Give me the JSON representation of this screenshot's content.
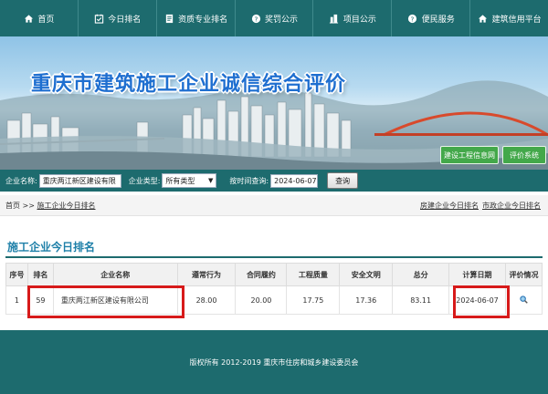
{
  "nav": [
    {
      "label": "首页",
      "icon": "home-icon"
    },
    {
      "label": "今日排名",
      "icon": "calendar-check-icon"
    },
    {
      "label": "资质专业排名",
      "icon": "document-icon"
    },
    {
      "label": "奖罚公示",
      "icon": "question-circle-icon"
    },
    {
      "label": "项目公示",
      "icon": "building-icon"
    },
    {
      "label": "便民服务",
      "icon": "help-icon"
    },
    {
      "label": "建筑信用平台",
      "icon": "home-icon"
    }
  ],
  "banner": {
    "title": "重庆市建筑施工企业诚信综合评价",
    "btn_info": "建设工程信息网",
    "btn_eval": "评价系统"
  },
  "search": {
    "company_label": "企业名称:",
    "company_value": "重庆两江新区建设有限",
    "type_label": "企业类型:",
    "type_value": "所有类型",
    "date_label": "按时间查询:",
    "date_value": "2024-06-07",
    "query_button": "查询"
  },
  "breadcrumb": {
    "home": "首页",
    "sep": ">>",
    "current": "施工企业今日排名",
    "right_1": "房建企业今日排名",
    "right_2": "市政企业今日排名"
  },
  "section": {
    "title": "施工企业今日排名"
  },
  "table": {
    "headers": [
      "序号",
      "排名",
      "企业名称",
      "遵常行为",
      "合同履约",
      "工程质量",
      "安全文明",
      "总分",
      "计算日期",
      "评价情况"
    ],
    "rows": [
      {
        "index": "1",
        "rank": "59",
        "company": "重庆两江新区建设有限公司",
        "behavior": "28.00",
        "contract": "20.00",
        "quality": "17.75",
        "safety": "17.36",
        "total": "83.11",
        "date": "2024-06-07",
        "detail_icon": "magnifier-icon"
      }
    ]
  },
  "footer": {
    "copyright": "版权所有 2012-2019 重庆市住房和城乡建设委员会"
  },
  "colors": {
    "primary": "#1d6b6e",
    "title_blue": "#1d7fa8",
    "highlight": "#d71a1a",
    "banner_button": "#43a84a"
  }
}
